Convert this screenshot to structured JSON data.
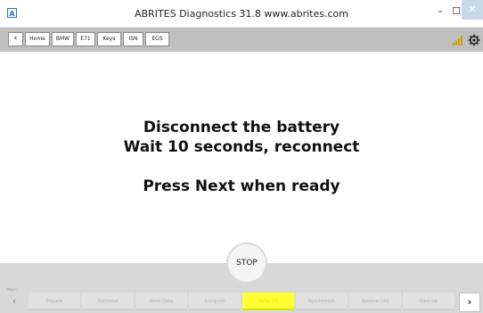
{
  "window": {
    "title": "ABRITES Diagnostics 31.8  www.abrites.com",
    "app_icon": "A",
    "minimize": "–",
    "maximize": "☐",
    "close": "✕"
  },
  "toolbar": {
    "back": "‹",
    "crumbs": [
      "Home",
      "BMW",
      "E71",
      "Keys",
      "ISN",
      "EGS"
    ]
  },
  "message": {
    "line1": "Disconnect the battery",
    "line2": "Wait 10 seconds, reconnect",
    "line3": "Press Next when ready"
  },
  "stop_button": "STOP",
  "steps": {
    "label": "steps:",
    "back": "‹",
    "next": "›",
    "items": [
      "Prepare",
      "Authorize",
      "Read Data",
      "Compute",
      "Write ISN",
      "Synchronize",
      "Restore CAS",
      "Cleanup"
    ],
    "active_index": 4
  }
}
